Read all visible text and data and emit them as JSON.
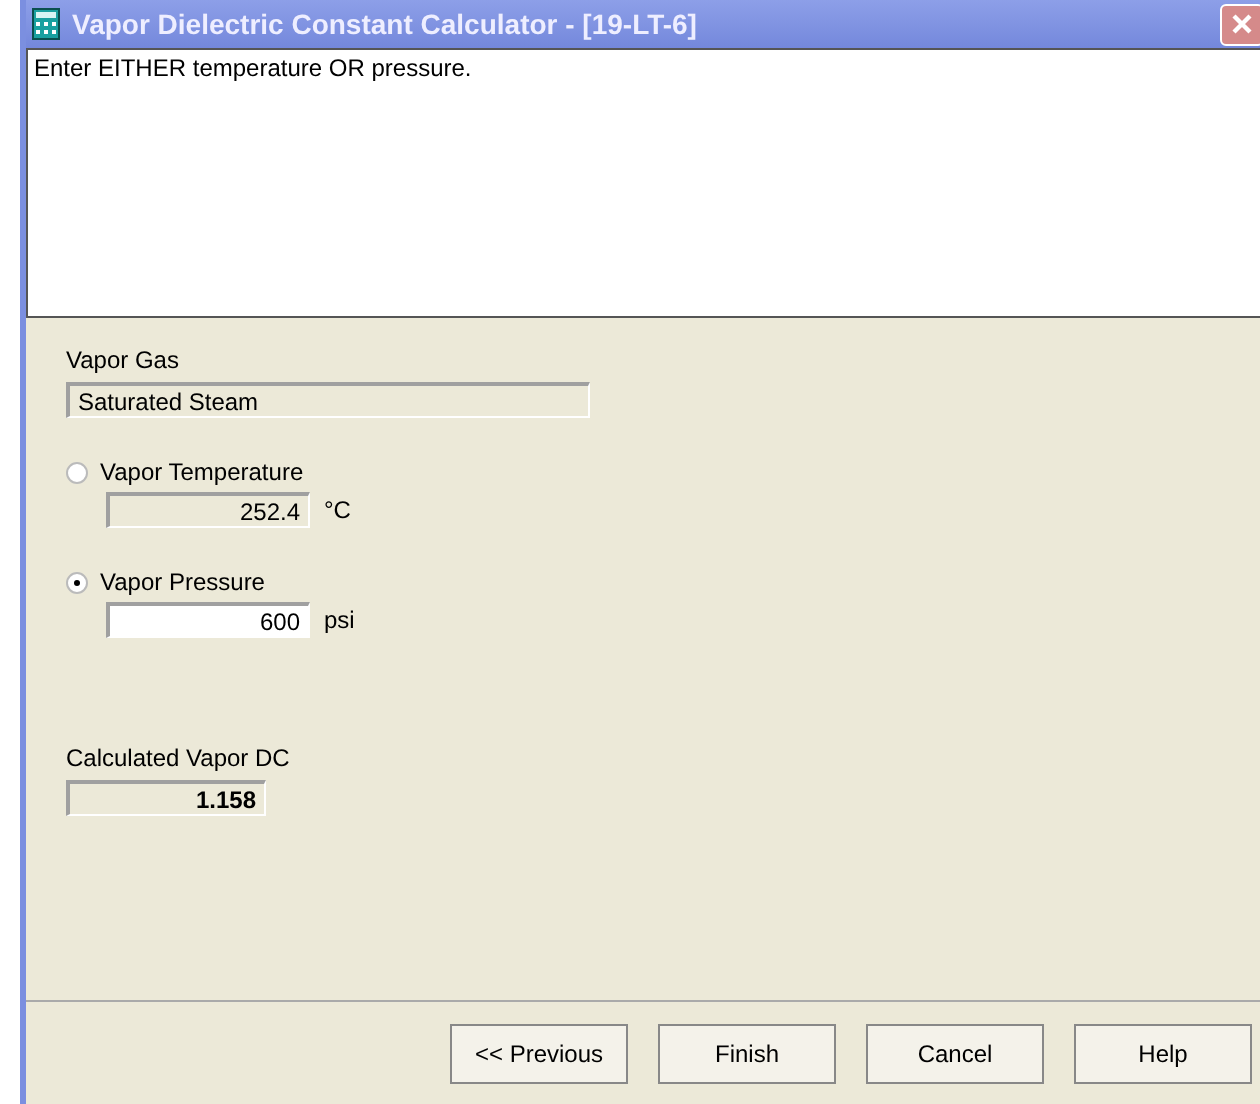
{
  "window": {
    "title": "Vapor Dielectric Constant Calculator - [19-LT-6]"
  },
  "message": "Enter EITHER temperature OR pressure.",
  "vapor_gas": {
    "label": "Vapor Gas",
    "value": "Saturated Steam"
  },
  "inputs": [
    {
      "label": "Vapor Temperature",
      "selected": false,
      "value": "252.4",
      "unit": "°C",
      "disabled": true
    },
    {
      "label": "Vapor Pressure",
      "selected": true,
      "value": "600",
      "unit": "psi",
      "disabled": false
    }
  ],
  "result": {
    "label": "Calculated Vapor DC",
    "value": "1.158"
  },
  "buttons": [
    "<< Previous",
    "Finish",
    "Cancel",
    "Help"
  ]
}
